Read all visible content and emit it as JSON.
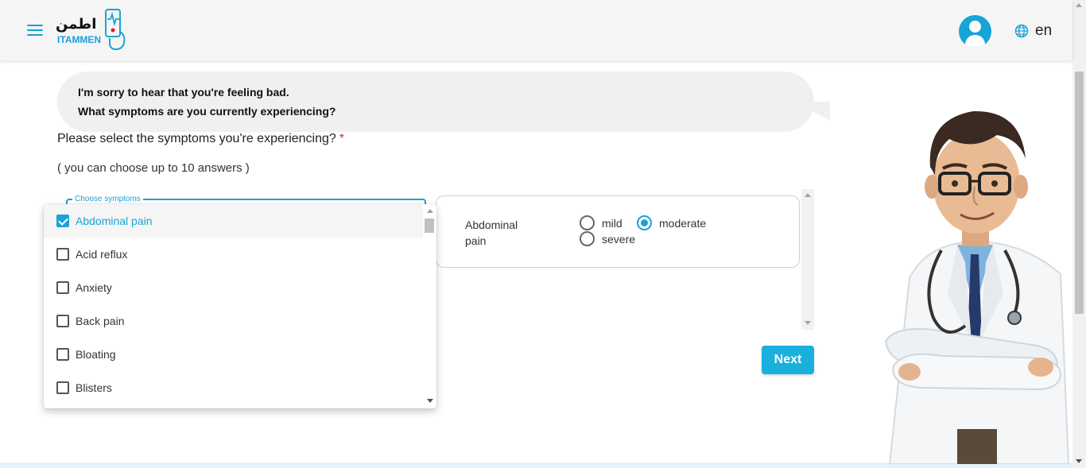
{
  "header": {
    "logo_arabic": "اطمن",
    "logo_english": "ITAMMEN",
    "language": "en"
  },
  "bubble": {
    "line1": "I'm sorry to hear that you're feeling bad.",
    "line2": "What symptoms are you currently experiencing?"
  },
  "form": {
    "question": "Please select the symptoms you're experiencing?",
    "required_mark": "*",
    "hint": "( you can choose up to 10 answers )",
    "select_label": "Choose symptoms",
    "options": [
      {
        "label": "Abdominal pain",
        "checked": true
      },
      {
        "label": "Acid reflux",
        "checked": false
      },
      {
        "label": "Anxiety",
        "checked": false
      },
      {
        "label": "Back pain",
        "checked": false
      },
      {
        "label": "Bloating",
        "checked": false
      },
      {
        "label": "Blisters",
        "checked": false
      }
    ]
  },
  "severity": {
    "symptom": "Abdominal pain",
    "levels": [
      {
        "label": "mild",
        "selected": false
      },
      {
        "label": "moderate",
        "selected": true
      },
      {
        "label": "severe",
        "selected": false
      }
    ]
  },
  "actions": {
    "next_label": "Next"
  },
  "colors": {
    "accent": "#1aa3d6",
    "button": "#1ab0de",
    "bubble": "#f0f0f3"
  }
}
